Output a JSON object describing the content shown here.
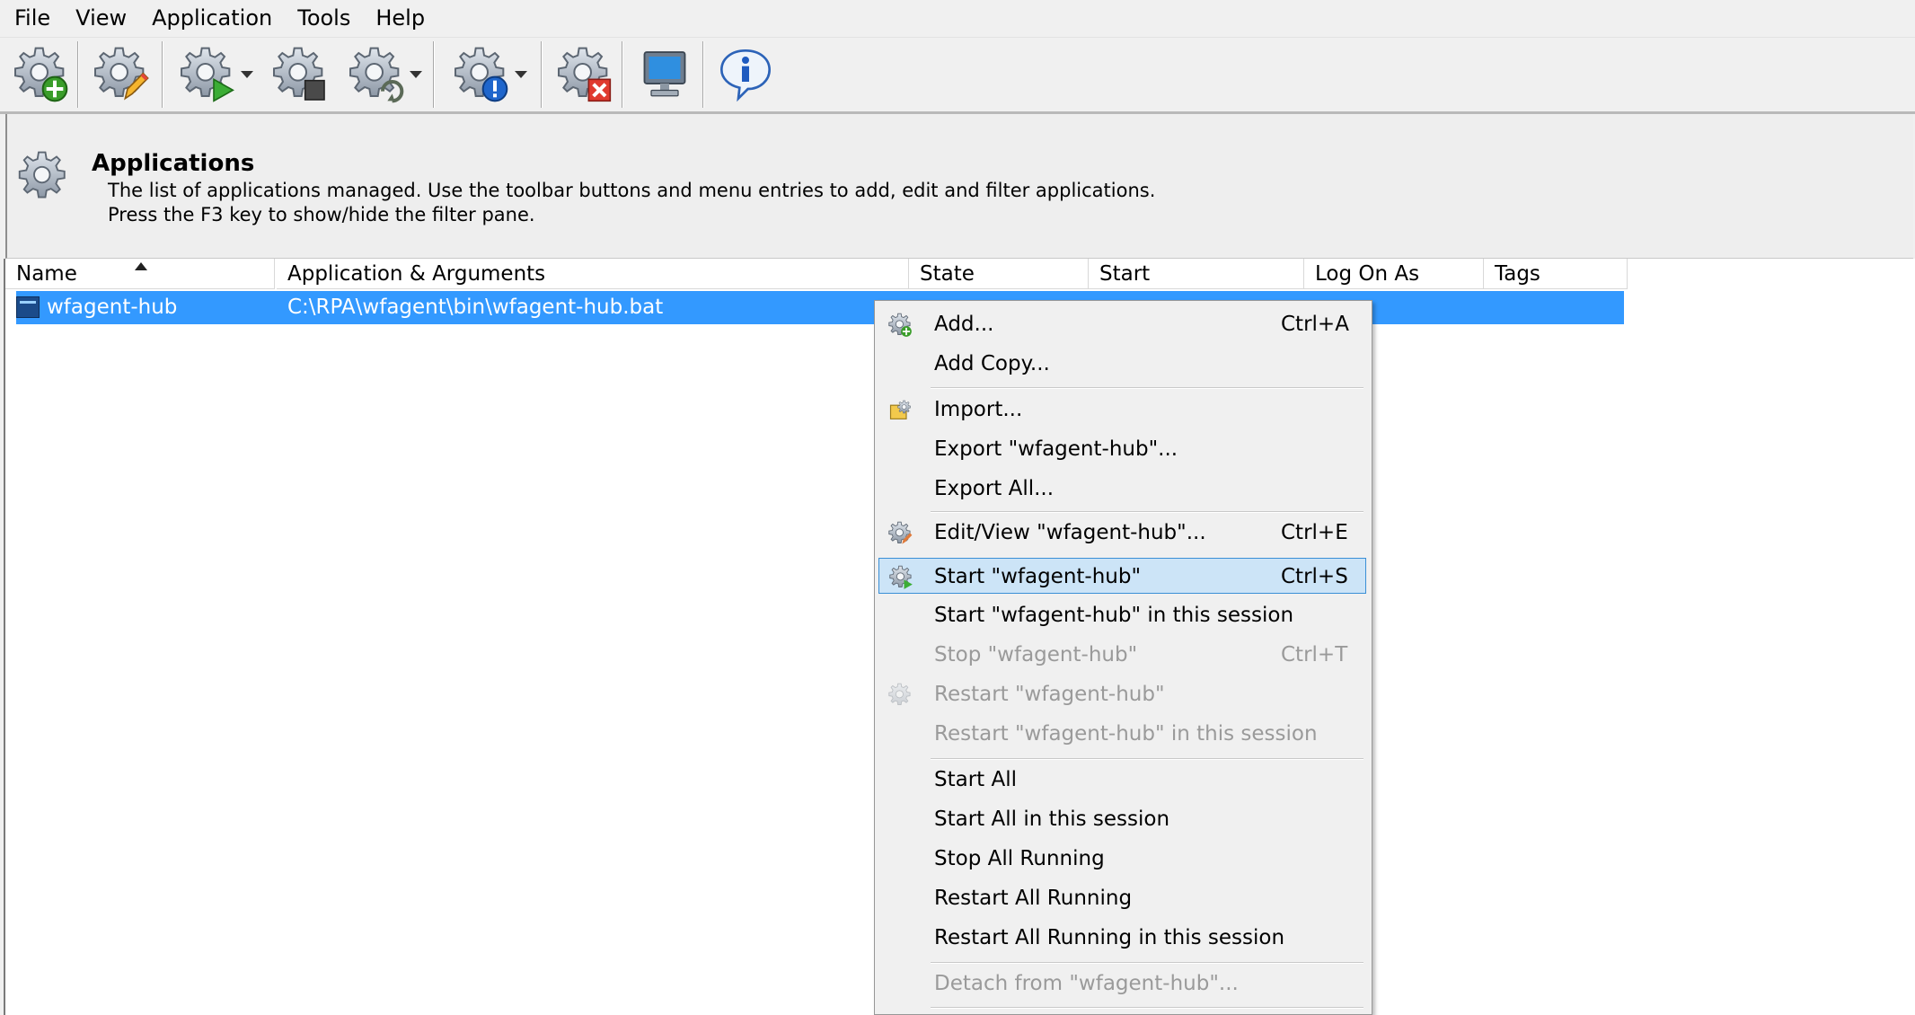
{
  "menubar": {
    "items": [
      "File",
      "View",
      "Application",
      "Tools",
      "Help"
    ]
  },
  "toolbar": {
    "buttons": [
      {
        "icon": "gear-add-icon"
      },
      {
        "icon": "gear-edit-icon"
      },
      {
        "icon": "gear-start-icon",
        "dropdown": true
      },
      {
        "icon": "gear-stop-icon"
      },
      {
        "icon": "gear-restart-icon",
        "dropdown": true
      },
      {
        "icon": "gear-info-icon",
        "dropdown": true
      },
      {
        "icon": "gear-delete-icon"
      },
      {
        "icon": "monitor-icon"
      },
      {
        "icon": "info-icon"
      }
    ]
  },
  "info": {
    "title": "Applications",
    "line1": "The list of applications managed. Use the toolbar buttons and menu entries to add, edit and filter applications.",
    "line2": "Press the F3 key to show/hide the filter pane."
  },
  "grid": {
    "columns": [
      "Name",
      "Application & Arguments",
      "State",
      "Start",
      "Log On As",
      "Tags"
    ],
    "sort_column": "Name",
    "rows": [
      {
        "name": "wfagent-hub",
        "app": "C:\\RPA\\wfagent\\bin\\wfagent-hub.bat",
        "state": "",
        "start": "",
        "logon": "",
        "tags": ""
      }
    ]
  },
  "context_menu": {
    "items": [
      {
        "label": "Add...",
        "shortcut": "Ctrl+A",
        "icon": "gear-add-icon",
        "disabled": false
      },
      {
        "label": "Add Copy...",
        "shortcut": "",
        "disabled": false
      },
      {
        "label": "Import...",
        "shortcut": "",
        "icon": "import-icon",
        "disabled": false
      },
      {
        "label": "Export \"wfagent-hub\"...",
        "shortcut": "",
        "disabled": false
      },
      {
        "label": "Export All...",
        "shortcut": "",
        "disabled": false
      },
      {
        "label": "Edit/View \"wfagent-hub\"...",
        "shortcut": "Ctrl+E",
        "icon": "gear-edit-icon",
        "disabled": false
      },
      {
        "label": "Start \"wfagent-hub\"",
        "shortcut": "Ctrl+S",
        "icon": "gear-start-icon",
        "disabled": false,
        "highlighted": true
      },
      {
        "label": "Start \"wfagent-hub\" in this session",
        "shortcut": "",
        "disabled": false
      },
      {
        "label": "Stop \"wfagent-hub\"",
        "shortcut": "Ctrl+T",
        "disabled": true
      },
      {
        "label": "Restart \"wfagent-hub\"",
        "shortcut": "",
        "icon": "gear-restart-icon",
        "disabled": true
      },
      {
        "label": "Restart \"wfagent-hub\" in this session",
        "shortcut": "",
        "disabled": true
      },
      {
        "label": "Start All",
        "shortcut": "",
        "disabled": false
      },
      {
        "label": "Start All in this session",
        "shortcut": "",
        "disabled": false
      },
      {
        "label": "Stop All Running",
        "shortcut": "",
        "disabled": false
      },
      {
        "label": "Restart All Running",
        "shortcut": "",
        "disabled": false
      },
      {
        "label": "Restart All Running in this session",
        "shortcut": "",
        "disabled": false
      },
      {
        "label": "Detach from \"wfagent-hub\"...",
        "shortcut": "",
        "disabled": true
      }
    ]
  },
  "colors": {
    "selection": "#3399ff",
    "menu_highlight": "#cce4f7",
    "gear": "#a9b4c0"
  }
}
